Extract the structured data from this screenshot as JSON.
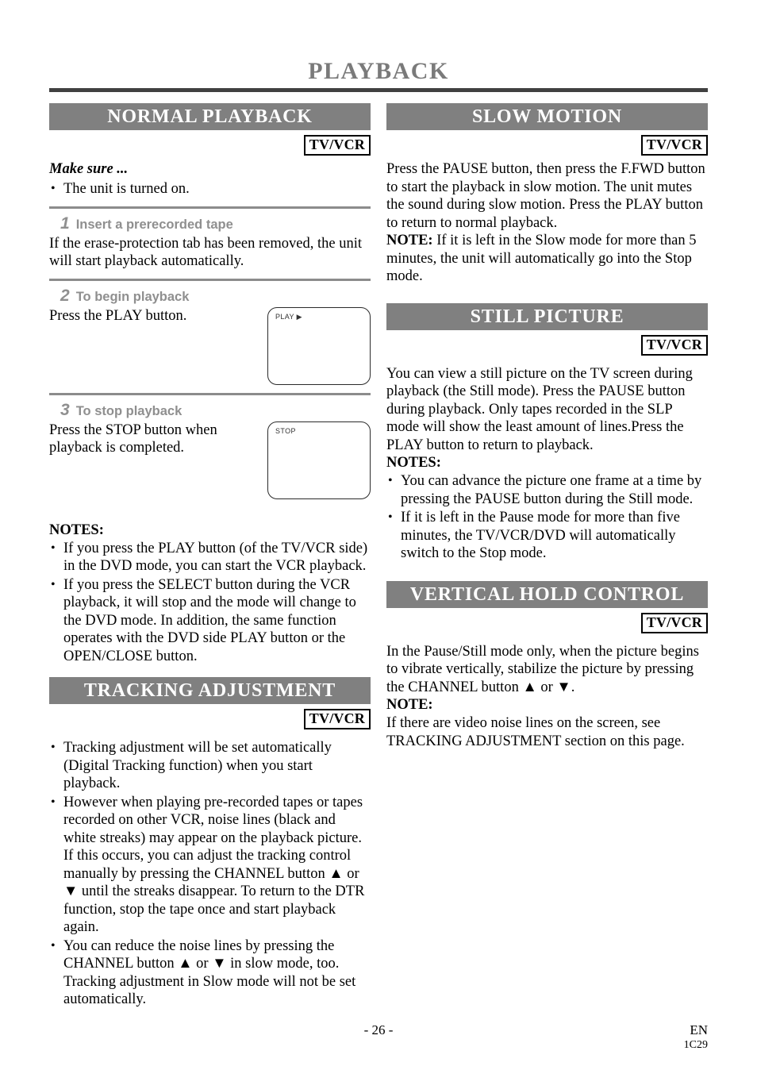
{
  "page": {
    "title": "PLAYBACK",
    "footer": {
      "page_number": "- 26 -",
      "language": "EN",
      "code": "1C29"
    }
  },
  "badges": {
    "tv_vcr": "TV/VCR"
  },
  "left_column": {
    "normal_playback": {
      "heading": "NORMAL PLAYBACK",
      "badge": "TV/VCR",
      "make_sure_label": "Make sure ...",
      "make_sure_items": [
        "The unit is turned on."
      ],
      "steps": [
        {
          "number": "1",
          "title": "Insert a prerecorded tape",
          "body": "If the erase-protection tab has been removed, the unit will start playback automatically.",
          "display": null
        },
        {
          "number": "2",
          "title": "To begin playback",
          "body": "Press the PLAY button.",
          "display": "PLAY ▶"
        },
        {
          "number": "3",
          "title": "To stop playback",
          "body": "Press the STOP button when playback is completed.",
          "display": "STOP"
        }
      ],
      "notes_label": "NOTES:",
      "notes": [
        "If you press the PLAY button (of the TV/VCR side) in the DVD mode, you can start the VCR playback.",
        "If you press the SELECT button during the VCR playback, it will stop and the mode will change to the DVD mode. In addition, the same function operates with the DVD side PLAY button or the OPEN/CLOSE button."
      ]
    },
    "tracking_adjustment": {
      "heading": "TRACKING ADJUSTMENT",
      "badge": "TV/VCR",
      "bullets": [
        "Tracking adjustment will be set automatically (Digital Tracking function) when you start playback.",
        "However when playing pre-recorded tapes or tapes recorded on other VCR, noise lines (black and white streaks) may appear on the playback picture. If this occurs, you can adjust the tracking control manually by pressing the CHANNEL button ▲ or ▼ until the streaks disappear. To return to the DTR function, stop the tape once and start playback again.",
        "You can reduce the noise lines by pressing the CHANNEL button ▲ or ▼ in slow mode, too. Tracking adjustment in Slow mode will not be set automatically."
      ]
    }
  },
  "right_column": {
    "slow_motion": {
      "heading": "SLOW MOTION",
      "badge": "TV/VCR",
      "body": "Press the PAUSE button, then press the F.FWD button to start the playback in slow motion. The unit mutes the sound during slow motion. Press the PLAY button to return to normal playback.",
      "note_label": "NOTE:",
      "note_body": "If it is left in the Slow mode for more than 5 minutes, the unit will automatically go into the Stop mode."
    },
    "still_picture": {
      "heading": "STILL PICTURE",
      "badge": "TV/VCR",
      "body": "You can view a still picture on the TV screen during playback (the Still mode). Press the PAUSE button during playback. Only tapes recorded in the SLP mode will show the least amount of lines.Press the PLAY button to return to playback.",
      "notes_label": "NOTES:",
      "notes": [
        "You can advance the picture one frame at a time by pressing the PAUSE button during the Still mode.",
        "If it is left in the Pause mode for more than five minutes, the TV/VCR/DVD will automatically switch to the Stop mode."
      ]
    },
    "vertical_hold_control": {
      "heading": "VERTICAL HOLD CONTROL",
      "badge": "TV/VCR",
      "body": "In the Pause/Still mode only, when the picture begins to vibrate vertically, stabilize the picture by pressing the CHANNEL button ▲ or ▼.",
      "note_label": "NOTE:",
      "note_body": "If there are video noise lines on the screen, see TRACKING ADJUSTMENT section on this page."
    }
  },
  "colors": {
    "section_bar": "#808080",
    "title_text": "#7a7a7a",
    "title_rule": "#414141",
    "step_accent": "#8f8f8f",
    "step_rule": "#8c8c8c"
  }
}
